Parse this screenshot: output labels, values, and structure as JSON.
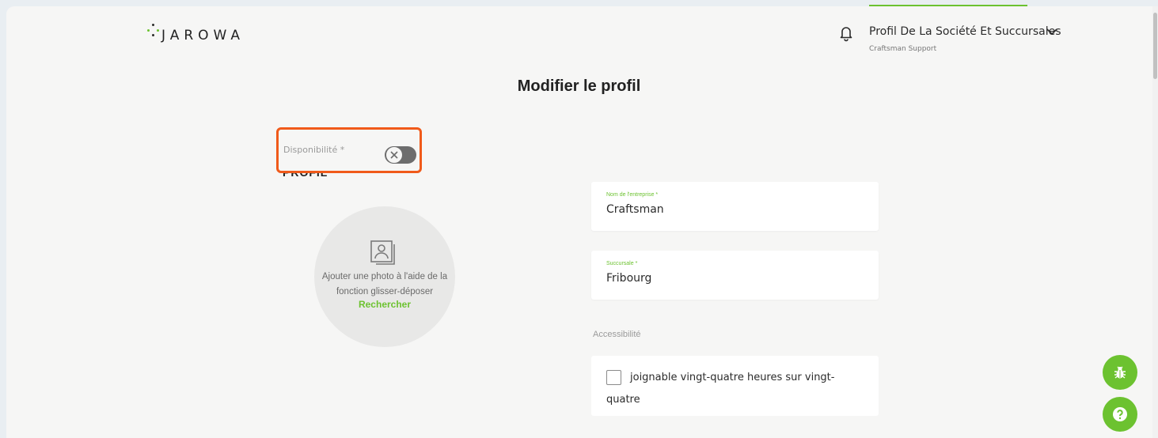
{
  "header": {
    "logo_text": "JAROWA",
    "account_title": "Profil De La Société Et Succursales",
    "account_subtitle": "Craftsman Support"
  },
  "page": {
    "title": "Modifier le profil"
  },
  "availability": {
    "label": "Disponibilité *",
    "enabled": false
  },
  "profile_section": {
    "heading": "PROFIL",
    "photo_hint": "Ajouter une photo à l'aide de la fonction glisser-déposer",
    "browse_link": "Rechercher"
  },
  "form": {
    "company_label": "Nom de l'entreprise *",
    "company_value": "Craftsman",
    "branch_label": "Succursale *",
    "branch_value": "Fribourg",
    "accessibility_label": "Accessibilité",
    "always_reachable_label": "joignable vingt-quatre heures sur vingt-quatre",
    "always_reachable_checked": false
  },
  "colors": {
    "accent": "#6cc230",
    "highlight": "#f05a1a",
    "toggle_off": "#6d6d6d"
  },
  "icons": [
    "bell-icon",
    "chevron-down-icon",
    "close-icon",
    "image-placeholder-icon",
    "bug-icon",
    "help-icon"
  ]
}
